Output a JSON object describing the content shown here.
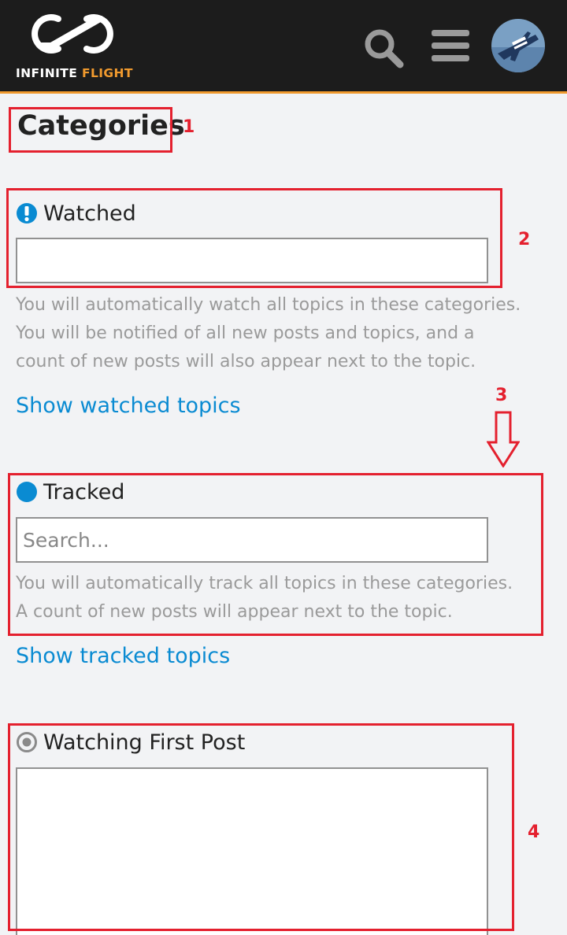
{
  "header": {
    "logo": {
      "word1": "INFINITE",
      "word2": "FLIGHT"
    },
    "icons": {
      "search": "search-icon",
      "menu": "hamburger-menu-icon",
      "avatar": "user-avatar"
    }
  },
  "page": {
    "title": "Categories"
  },
  "sections": {
    "watched": {
      "label": "Watched",
      "icon": "exclamation-circle-icon",
      "value": "",
      "placeholder": "",
      "description": [
        "You will automatically watch all topics in these categories.",
        "You will be notified of all new posts and topics, and a",
        "count of new posts will also appear next to the topic."
      ],
      "link": "Show watched topics"
    },
    "tracked": {
      "label": "Tracked",
      "icon": "filled-circle-icon",
      "value": "",
      "placeholder": "Search...",
      "description": [
        "You will automatically track all topics in these categories.",
        "A count of new posts will appear next to the topic."
      ],
      "link": "Show tracked topics"
    },
    "watching_first_post": {
      "label": "Watching First Post",
      "icon": "dot-circle-icon",
      "value": ""
    }
  },
  "annotations": [
    "1",
    "2",
    "3",
    "4"
  ],
  "colors": {
    "header_bg": "#1c1c1c",
    "brand_orange": "#f19a2e",
    "link_blue": "#0a8bd2",
    "annotation_red": "#e4202e"
  }
}
